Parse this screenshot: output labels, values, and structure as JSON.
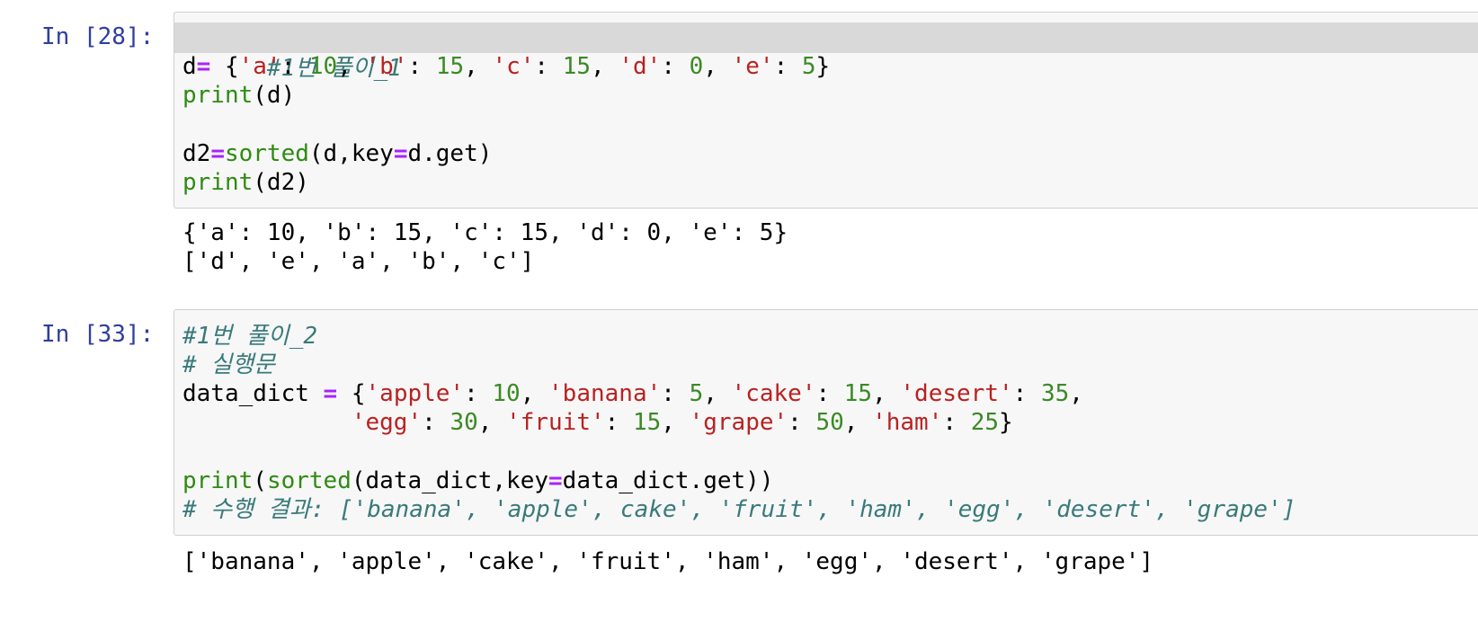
{
  "cells": [
    {
      "prompt": "In [28]:",
      "code": {
        "line1": "#1번 풀이_1",
        "line2": {
          "a": "d",
          "b": "=",
          "c": " {",
          "d": "'a'",
          "e": ": ",
          "f": "10",
          "g": ", ",
          "h": "'b'",
          "i": ": ",
          "j": "15",
          "k": ", ",
          "l": "'c'",
          "m": ": ",
          "n": "15",
          "o": ", ",
          "p": "'d'",
          "q": ": ",
          "r": "0",
          "s": ", ",
          "t": "'e'",
          "u": ": ",
          "v": "5",
          "w": "}"
        },
        "line3": {
          "fn": "print",
          "rest": "(d)"
        },
        "line5": {
          "a": "d2",
          "b": "=",
          "c": "sorted",
          "d": "(d,key",
          "e": "=",
          "f": "d.get)"
        },
        "line6": {
          "fn": "print",
          "rest": "(d2)"
        }
      },
      "output": [
        "{'a': 10, 'b': 15, 'c': 15, 'd': 0, 'e': 5}",
        "['d', 'e', 'a', 'b', 'c']"
      ]
    },
    {
      "prompt": "In [33]:",
      "code": {
        "line1": "#1번 풀이_2",
        "line2": "# 실행문",
        "line3": {
          "a": "data_dict ",
          "b": "=",
          "c": " {",
          "d": "'apple'",
          "e": ": ",
          "f": "10",
          "g": ", ",
          "h": "'banana'",
          "i": ": ",
          "j": "5",
          "k": ", ",
          "l": "'cake'",
          "m": ": ",
          "n": "15",
          "o": ", ",
          "p": "'desert'",
          "q": ": ",
          "r": "35",
          "s": ","
        },
        "line4": {
          "a": "            ",
          "b": "'egg'",
          "c": ": ",
          "d": "30",
          "e": ", ",
          "f": "'fruit'",
          "g": ": ",
          "h": "15",
          "i": ", ",
          "j": "'grape'",
          "k": ": ",
          "l": "50",
          "m": ", ",
          "n": "'ham'",
          "o": ": ",
          "p": "25",
          "q": "}"
        },
        "line6": {
          "a": "print",
          "b": "(",
          "c": "sorted",
          "d": "(data_dict,key",
          "e": "=",
          "f": "data_dict.get))"
        },
        "line7": "# 수행 결과: ['banana', 'apple', cake', 'fruit', 'ham', 'egg', 'desert', 'grape']"
      },
      "output": [
        "['banana', 'apple', 'cake', 'fruit', 'ham', 'egg', 'desert', 'grape']"
      ]
    }
  ]
}
